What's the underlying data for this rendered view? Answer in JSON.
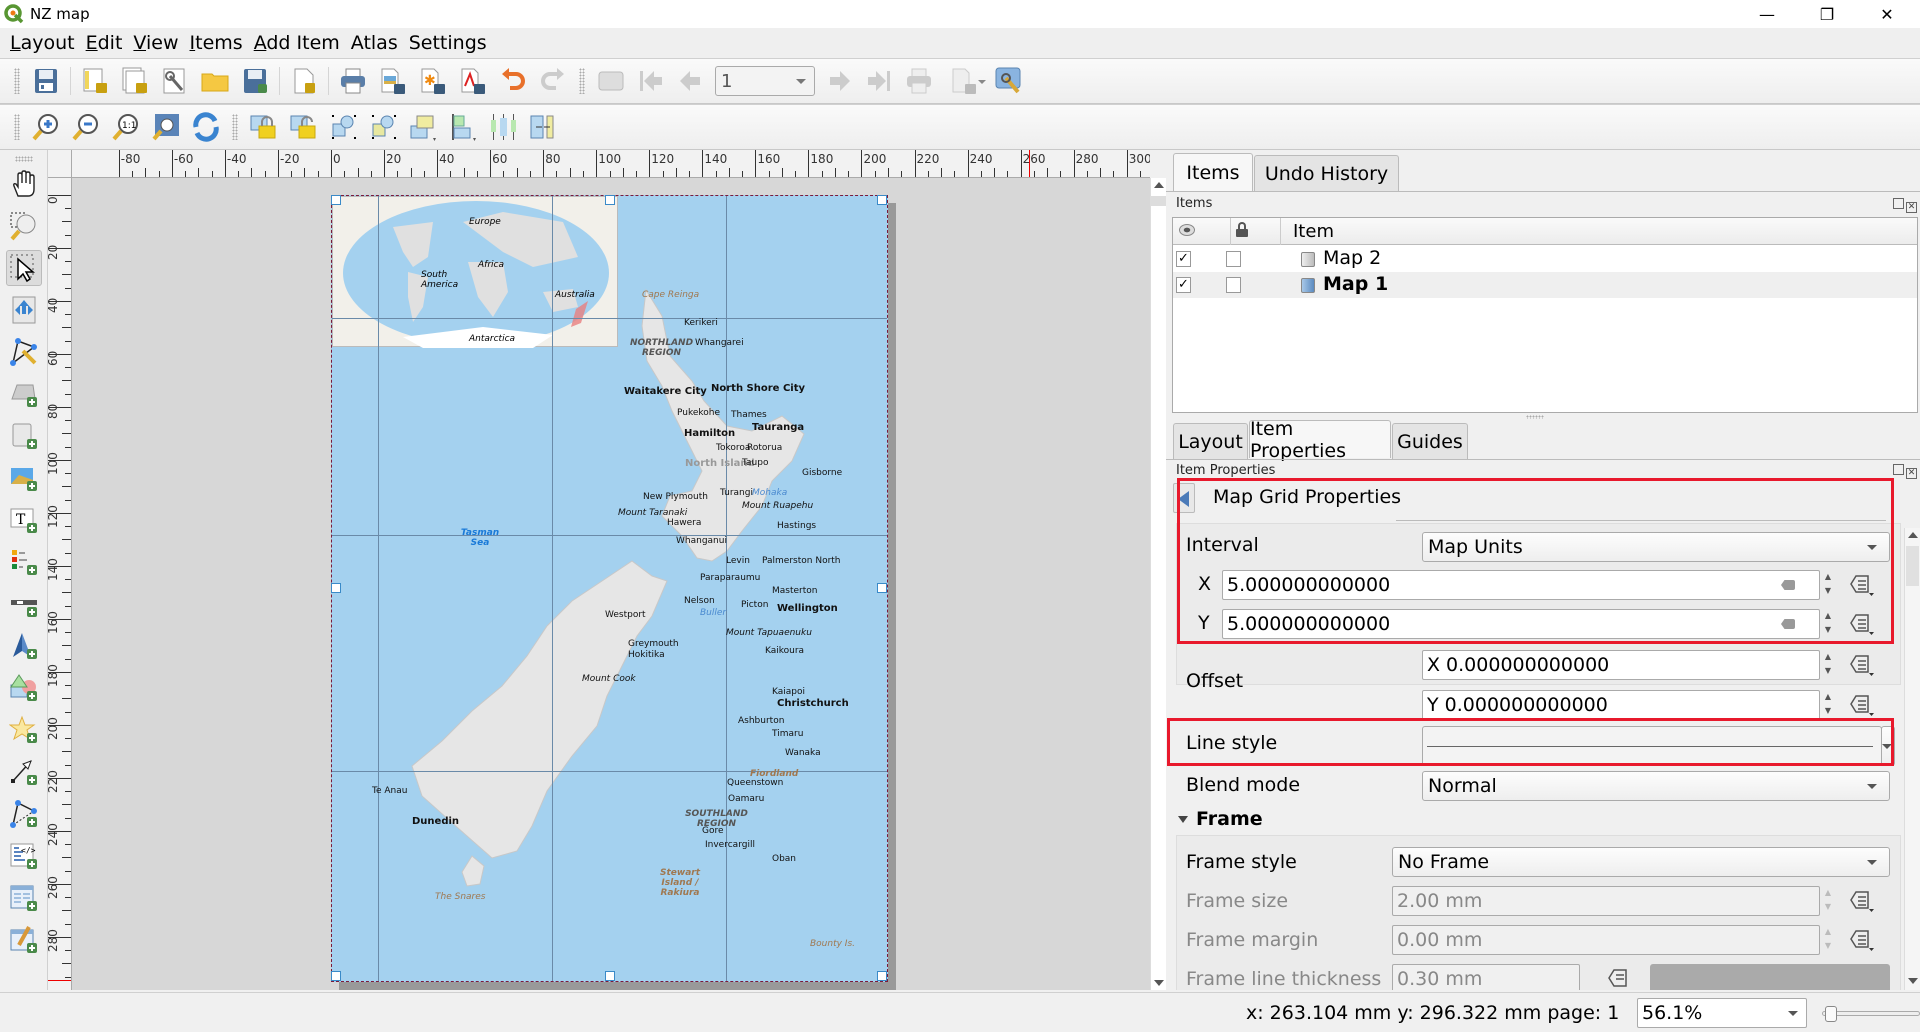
{
  "window": {
    "title": "NZ map",
    "controls": {
      "minimize": "—",
      "maximize": "❐",
      "close": "✕"
    }
  },
  "menubar": {
    "items": [
      {
        "label": "Layout",
        "mnemonic": "L",
        "rest": "ayout"
      },
      {
        "label": "Edit",
        "mnemonic": "E",
        "rest": "dit"
      },
      {
        "label": "View",
        "mnemonic": "V",
        "rest": "iew"
      },
      {
        "label": "Items",
        "mnemonic": "I",
        "rest": "tems"
      },
      {
        "label": "Add Item",
        "mnemonic": "A",
        "rest": "dd Item"
      },
      {
        "label": "Atlas",
        "mnemonic": "",
        "rest": "Atlas"
      },
      {
        "label": "Settings",
        "mnemonic": "",
        "rest": "Settings"
      }
    ]
  },
  "toolbar1": {
    "icons": [
      "save-icon",
      "new-layout-icon",
      "duplicate-layout-icon",
      "layout-manager-icon",
      "open-folder-icon",
      "save-as-template-icon",
      "new-page-icon",
      "print-icon",
      "export-image-icon",
      "export-svg-icon",
      "export-pdf-icon",
      "undo-icon",
      "redo-icon",
      "atlas-preview-icon",
      "atlas-first-icon",
      "atlas-previous-icon",
      "atlas-next-icon",
      "atlas-last-icon",
      "atlas-print-icon",
      "atlas-export-icon",
      "atlas-settings-icon"
    ],
    "atlas_page_value": "1"
  },
  "toolbar2": {
    "icons": [
      "zoom-in-icon",
      "zoom-out-icon",
      "zoom-100-icon",
      "zoom-full-icon",
      "refresh-icon",
      "lock-items-icon",
      "unlock-items-icon",
      "select-all-icon",
      "deselect-icon",
      "raise-items-icon",
      "align-left-icon",
      "distribute-icon",
      "resize-icon"
    ]
  },
  "ruler": {
    "h_labels": [
      "-80",
      "-60",
      "-40",
      "-20",
      "0",
      "20",
      "40",
      "60",
      "80",
      "100",
      "120",
      "140",
      "160",
      "180",
      "200",
      "220",
      "240",
      "260",
      "280",
      "300"
    ],
    "v_labels": [
      "0",
      "20",
      "40",
      "60",
      "80",
      "100",
      "120",
      "140",
      "160",
      "180",
      "200",
      "220",
      "240",
      "260",
      "280"
    ]
  },
  "toolbox": {
    "tools": [
      "pan-icon",
      "zoom-tool-icon",
      "select-move-icon",
      "move-content-icon",
      "edit-nodes-icon",
      "add-map-icon",
      "add-3d-map-icon",
      "add-picture-icon",
      "add-label-icon",
      "add-legend-icon",
      "add-scalebar-icon",
      "add-north-arrow-icon",
      "add-shape-icon",
      "add-marker-icon",
      "add-arrow-icon",
      "add-node-item-icon",
      "add-html-icon",
      "add-attribute-table-icon",
      "add-fixed-table-icon"
    ]
  },
  "map": {
    "inset_labels": [
      "Europe",
      "Africa",
      "South America",
      "Australia",
      "Antarctica"
    ],
    "labels": [
      {
        "t": "Cape Reinga",
        "c": "#a07850",
        "i": true
      },
      {
        "t": "Kerikeri"
      },
      {
        "t": "Whangarei"
      },
      {
        "t": "NORTHLAND REGION",
        "c": "#555",
        "b": true,
        "i": true
      },
      {
        "t": "Waitakere City",
        "b": true
      },
      {
        "t": "North Shore City",
        "b": true
      },
      {
        "t": "Pukekohe"
      },
      {
        "t": "Thames"
      },
      {
        "t": "Tauranga",
        "b": true
      },
      {
        "t": "Hamilton",
        "b": true
      },
      {
        "t": "Tokoroa"
      },
      {
        "t": "Rotorua"
      },
      {
        "t": "North Island",
        "c": "#999",
        "b": true
      },
      {
        "t": "Taupo"
      },
      {
        "t": "Gisborne"
      },
      {
        "t": "New Plymouth"
      },
      {
        "t": "Turangi"
      },
      {
        "t": "Mohaka",
        "c": "#4a8ad0",
        "i": true
      },
      {
        "t": "Mount Taranaki",
        "i": true
      },
      {
        "t": "Mount Ruapehu",
        "i": true
      },
      {
        "t": "Hawera"
      },
      {
        "t": "Hastings"
      },
      {
        "t": "Whanganui"
      },
      {
        "t": "Tasman Sea",
        "c": "#1a7ad8",
        "b": true,
        "i": true
      },
      {
        "t": "Levin"
      },
      {
        "t": "Palmerston North"
      },
      {
        "t": "Paraparaumu"
      },
      {
        "t": "Masterton"
      },
      {
        "t": "Nelson"
      },
      {
        "t": "Picton"
      },
      {
        "t": "Wellington",
        "b": true
      },
      {
        "t": "Westport"
      },
      {
        "t": "Buller",
        "c": "#4a8ad0",
        "i": true
      },
      {
        "t": "Mount Tapuaenuku",
        "i": true
      },
      {
        "t": "Greymouth"
      },
      {
        "t": "Hokitika"
      },
      {
        "t": "Kaikoura"
      },
      {
        "t": "Kaiapoi"
      },
      {
        "t": "Mount Cook",
        "i": true
      },
      {
        "t": "Christchurch",
        "b": true
      },
      {
        "t": "Ashburton"
      },
      {
        "t": "Timaru"
      },
      {
        "t": "Wanaka"
      },
      {
        "t": "Fiordland",
        "c": "#a07850",
        "b": true,
        "i": true
      },
      {
        "t": "Queenstown"
      },
      {
        "t": "Oamaru"
      },
      {
        "t": "Te Anau"
      },
      {
        "t": "SOUTHLAND REGION",
        "c": "#555",
        "b": true,
        "i": true
      },
      {
        "t": "Gore"
      },
      {
        "t": "Dunedin",
        "b": true
      },
      {
        "t": "Invercargill"
      },
      {
        "t": "Oban"
      },
      {
        "t": "Stewart Island / Rakiura",
        "c": "#a07850",
        "b": true,
        "i": true
      },
      {
        "t": "Bounty Is.",
        "c": "#a07850",
        "i": true
      },
      {
        "t": "The Snares",
        "c": "#a07850",
        "i": true
      }
    ]
  },
  "panel_top": {
    "tabs": [
      {
        "label": "Items",
        "active": true
      },
      {
        "label": "Undo History",
        "active": false
      }
    ],
    "section_label": "Items",
    "columns": {
      "visible": "eye-icon",
      "lock": "lock-icon",
      "item": "Item"
    },
    "rows": [
      {
        "name": "Map 2",
        "visible": true,
        "locked": false,
        "bold": false,
        "visible_mark": "✓"
      },
      {
        "name": "Map 1",
        "visible": true,
        "locked": false,
        "bold": true,
        "visible_mark": "✓"
      }
    ]
  },
  "panel_bottom": {
    "tabs": [
      {
        "label": "Layout",
        "active": false
      },
      {
        "label": "Item Properties",
        "active": true
      },
      {
        "label": "Guides",
        "active": false
      }
    ],
    "section_label": "Item Properties",
    "header": "Map Grid Properties",
    "interval": {
      "label": "Interval",
      "unit": "Map Units",
      "x_label": "X",
      "x_value": "5.000000000000",
      "y_label": "Y",
      "y_value": "5.000000000000"
    },
    "offset": {
      "label": "Offset",
      "x_value": "X 0.000000000000",
      "y_value": "Y 0.000000000000"
    },
    "line_style": {
      "label": "Line style"
    },
    "blend_mode": {
      "label": "Blend mode",
      "value": "Normal"
    },
    "frame": {
      "header": "Frame",
      "style_label": "Frame style",
      "style_value": "No Frame",
      "size_label": "Frame size",
      "size_value": "2.00 mm",
      "margin_label": "Frame margin",
      "margin_value": "0.00 mm",
      "thickness_label": "Frame line thickness",
      "thickness_value": "0.30 mm"
    }
  },
  "statusbar": {
    "coords": "x: 263.104 mm y: 296.322 mm page: 1",
    "zoom": "56.1%",
    "zoom_slider_fraction": 0.02
  },
  "colors": {
    "highlight_box": "#e8192c",
    "sea": "#a4d1ef",
    "land": "#e6e6e6",
    "selection_frame": "#7a1a3a"
  }
}
